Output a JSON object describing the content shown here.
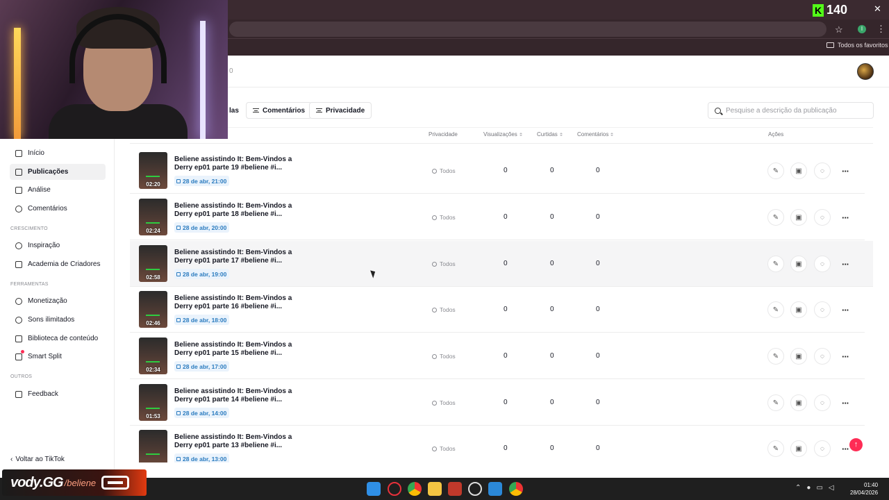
{
  "browser": {
    "bookmarks_folder": "Todos os favoritos",
    "profile_initial": "I",
    "star_icon": "star-icon",
    "menu_icon": "kebab-menu-icon"
  },
  "overlay": {
    "kick_count": "140",
    "vody_logo": "vody.GG",
    "vody_handle": "/beliene"
  },
  "header": {
    "count_fragment": "0"
  },
  "sidebar": {
    "items": [
      {
        "label": "Início",
        "icon": "home-icon"
      },
      {
        "label": "Publicações",
        "icon": "posts-icon",
        "active": true
      },
      {
        "label": "Análise",
        "icon": "analytics-icon"
      },
      {
        "label": "Comentários",
        "icon": "comment-icon"
      }
    ],
    "sections": {
      "growth": "CRESCIMENTO",
      "tools": "FERRAMENTAS",
      "others": "OUTROS"
    },
    "growth_items": [
      {
        "label": "Inspiração",
        "icon": "bulb-icon"
      },
      {
        "label": "Academia de Criadores",
        "icon": "academy-icon"
      }
    ],
    "tools_items": [
      {
        "label": "Monetização",
        "icon": "money-icon"
      },
      {
        "label": "Sons ilimitados",
        "icon": "music-icon"
      },
      {
        "label": "Biblioteca de conteúdo",
        "icon": "library-icon"
      },
      {
        "label": "Smart Split",
        "icon": "scissors-icon"
      }
    ],
    "other_items": [
      {
        "label": "Feedback",
        "icon": "feedback-icon"
      }
    ],
    "back_link": "Voltar ao TikTok"
  },
  "filters": {
    "partial": "las",
    "comments": "Comentários",
    "privacy": "Privacidade"
  },
  "search": {
    "placeholder": "Pesquise a descrição da publicação"
  },
  "table": {
    "headers": {
      "privacy": "Privacidade",
      "views": "Visualizações",
      "likes": "Curtidas",
      "comments": "Comentários",
      "actions": "Ações"
    },
    "rows": [
      {
        "title": "Beliene assistindo It: Bem-Vindos a Derry ep01 parte 19 #beliene #i...",
        "duration": "02:20",
        "date": "28 de abr, 21:00",
        "privacy": "Todos",
        "views": "0",
        "likes": "0",
        "comments": "0"
      },
      {
        "title": "Beliene assistindo It: Bem-Vindos a Derry ep01 parte 18 #beliene #i...",
        "duration": "02:24",
        "date": "28 de abr, 20:00",
        "privacy": "Todos",
        "views": "0",
        "likes": "0",
        "comments": "0"
      },
      {
        "title": "Beliene assistindo It: Bem-Vindos a Derry ep01 parte 17 #beliene #i...",
        "duration": "02:58",
        "date": "28 de abr, 19:00",
        "privacy": "Todos",
        "views": "0",
        "likes": "0",
        "comments": "0"
      },
      {
        "title": "Beliene assistindo It: Bem-Vindos a Derry ep01 parte 16 #beliene #i...",
        "duration": "02:46",
        "date": "28 de abr, 18:00",
        "privacy": "Todos",
        "views": "0",
        "likes": "0",
        "comments": "0"
      },
      {
        "title": "Beliene assistindo It: Bem-Vindos a Derry ep01 parte 15 #beliene #i...",
        "duration": "02:34",
        "date": "28 de abr, 17:00",
        "privacy": "Todos",
        "views": "0",
        "likes": "0",
        "comments": "0"
      },
      {
        "title": "Beliene assistindo It: Bem-Vindos a Derry ep01 parte 14 #beliene #i...",
        "duration": "01:53",
        "date": "28 de abr, 14:00",
        "privacy": "Todos",
        "views": "0",
        "likes": "0",
        "comments": "0"
      },
      {
        "title": "Beliene assistindo It: Bem-Vindos a Derry ep01 parte 13 #beliene #i...",
        "duration": "",
        "date": "28 de abr, 13:00",
        "privacy": "Todos",
        "views": "0",
        "likes": "0",
        "comments": "0"
      }
    ],
    "hover_row": 2
  },
  "taskbar": {
    "time": "01:40",
    "date": "28/04/2026"
  },
  "colors": {
    "accent": "#fe2c55",
    "date_badge": "#2a7bbf",
    "kick_green": "#53fc18"
  }
}
